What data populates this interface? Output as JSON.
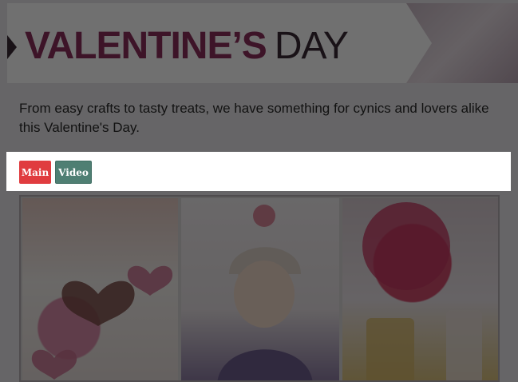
{
  "banner": {
    "title_bold": "VALENTINE’S",
    "title_light": "DAY"
  },
  "description": "From easy crafts to tasty treats, we have something for cynics and lovers alike this Valentine's Day.",
  "tabs": [
    {
      "label": "Main",
      "active": true,
      "color": "#e03c3f"
    },
    {
      "label": "Video",
      "active": false,
      "color": "#4f7f73"
    }
  ],
  "gallery": {
    "photos": [
      {
        "subject": "heart-cookies-photo"
      },
      {
        "subject": "girl-in-knit-hat-photo"
      },
      {
        "subject": "flowers-and-drinks-photo"
      }
    ]
  },
  "colors": {
    "brand_pink": "#8c2f5c",
    "dark": "#3a2b36",
    "overlay": "rgba(0,0,0,0.56)"
  }
}
